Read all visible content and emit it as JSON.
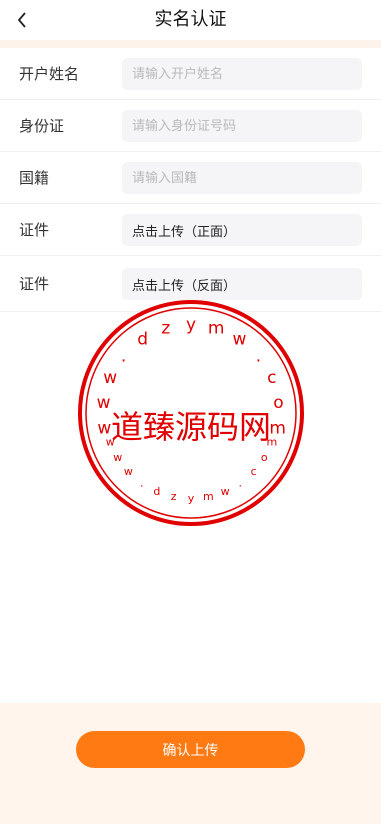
{
  "header": {
    "title": "实名认证",
    "back_icon": "chevron-left-icon"
  },
  "form": {
    "name": {
      "label": "开户姓名",
      "placeholder": "请输入开户姓名"
    },
    "id_card": {
      "label": "身份证",
      "placeholder": "请输入身份证号码"
    },
    "nationality": {
      "label": "国籍",
      "placeholder": "请输入国籍"
    },
    "doc_front": {
      "label": "证件",
      "action": "点击上传（正面）"
    },
    "doc_back": {
      "label": "证件",
      "action": "点击上传（反面）"
    }
  },
  "watermark": {
    "center_text": "道臻源码网",
    "top_chars": [
      "w",
      "w",
      "w",
      ".",
      "d",
      "z",
      "y",
      "m",
      "w",
      ".",
      "c",
      "o",
      "m"
    ],
    "bottom_chars": [
      "w",
      "w",
      "w",
      ".",
      "d",
      "z",
      "y",
      "m",
      "w",
      ".",
      "c",
      "o",
      "m"
    ],
    "color": "#e00000"
  },
  "footer": {
    "confirm_label": "确认上传",
    "accent": "#ff7a12"
  }
}
